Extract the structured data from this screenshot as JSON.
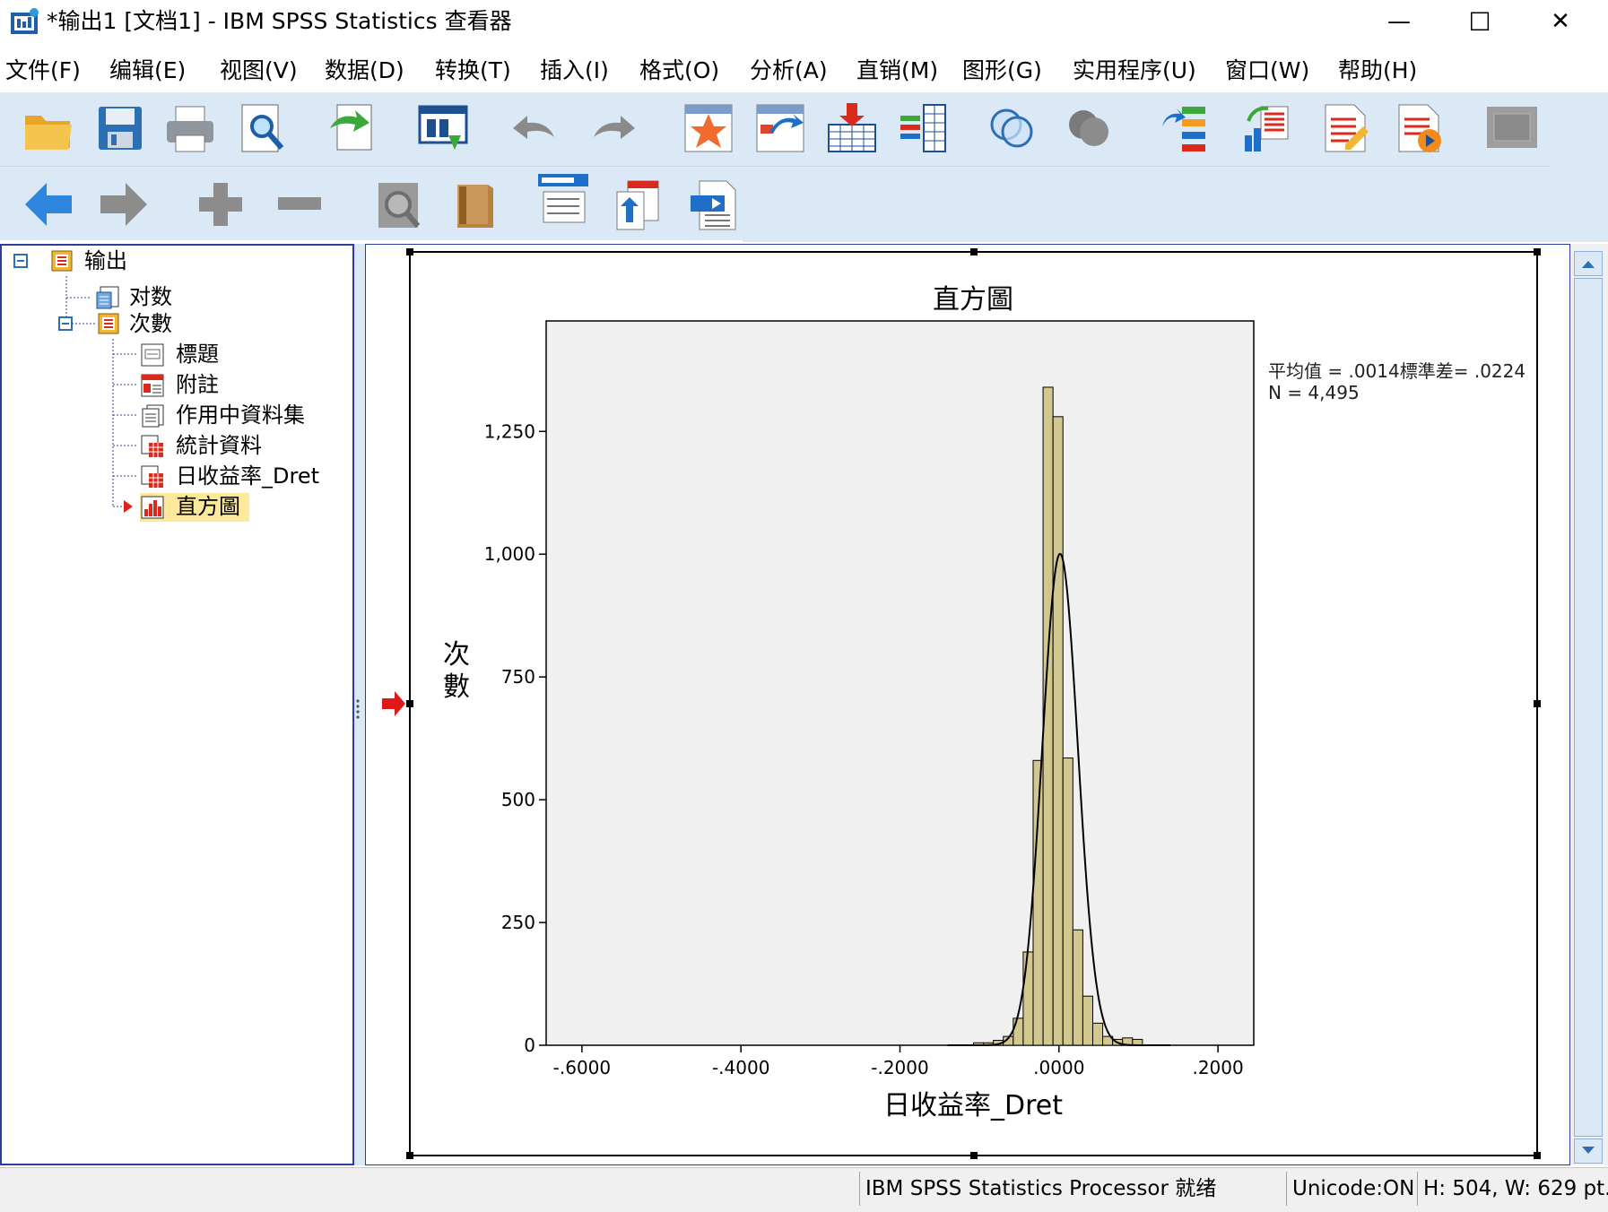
{
  "window": {
    "title": "*输出1 [文档1] - IBM SPSS Statistics 查看器",
    "minimize_glyph": "—",
    "maximize_glyph": "☐",
    "close_glyph": "✕"
  },
  "menu": [
    "文件(F)",
    "编辑(E)",
    "视图(V)",
    "数据(D)",
    "转换(T)",
    "插入(I)",
    "格式(O)",
    "分析(A)",
    "直销(M)",
    "图形(G)",
    "实用程序(U)",
    "窗口(W)",
    "帮助(H)"
  ],
  "toolbar1_icons": [
    "open-icon",
    "save-icon",
    "print-icon",
    "print-preview-icon",
    "export-icon",
    "recall-dialog-icon",
    "undo-icon",
    "redo-icon",
    "goto-case-icon",
    "goto-variable-icon",
    "insert-cases-icon",
    "variables-icon",
    "use-variable-sets-icon",
    "show-all-variables-icon",
    "split-file-icon",
    "select-cases-icon",
    "chart-builder-icon",
    "designate-window-icon",
    "run-script-icon",
    "disabled-icon"
  ],
  "toolbar2_icons": [
    "back-icon",
    "forward-icon",
    "expand-icon",
    "collapse-icon",
    "show-icon",
    "hide-icon",
    "insert-heading-icon",
    "insert-title-icon",
    "insert-text-icon"
  ],
  "outline": {
    "root": "输出",
    "log": "对数",
    "freq": "次數",
    "children": [
      "標題",
      "附註",
      "作用中資料集",
      "統計資料",
      "日收益率_Dret",
      "直方圖"
    ]
  },
  "chart_data": {
    "type": "bar",
    "title": "直方圖",
    "xlabel": "日收益率_Dret",
    "ylabel": "次數",
    "x_ticks": [
      "-.6000",
      "-.4000",
      "-.2000",
      ".0000",
      ".2000"
    ],
    "y_ticks": [
      "0",
      "250",
      "500",
      "750",
      "1,000",
      "1,250"
    ],
    "xlim": [
      -0.645,
      0.245
    ],
    "ylim": [
      0,
      1475
    ],
    "bin_width": 0.0125,
    "bins": [
      {
        "x0": -0.1075,
        "count": 5
      },
      {
        "x0": -0.095,
        "count": 5
      },
      {
        "x0": -0.0825,
        "count": 10
      },
      {
        "x0": -0.07,
        "count": 18
      },
      {
        "x0": -0.0575,
        "count": 55
      },
      {
        "x0": -0.045,
        "count": 190
      },
      {
        "x0": -0.0325,
        "count": 580
      },
      {
        "x0": -0.02,
        "count": 1340
      },
      {
        "x0": -0.0075,
        "count": 1280
      },
      {
        "x0": 0.005,
        "count": 585
      },
      {
        "x0": 0.0175,
        "count": 235
      },
      {
        "x0": 0.03,
        "count": 100
      },
      {
        "x0": 0.0425,
        "count": 45
      },
      {
        "x0": 0.055,
        "count": 18
      },
      {
        "x0": 0.0675,
        "count": 12
      },
      {
        "x0": 0.08,
        "count": 15
      },
      {
        "x0": 0.0925,
        "count": 12
      }
    ],
    "normal_curve": {
      "mean": 0.0014,
      "std": 0.0224,
      "n": 4495
    },
    "stats_line1": "平均值 = .0014標準差= .0224",
    "stats_line2": "N = 4,495",
    "bar_color": "#d2c78f",
    "plot_bg": "#f0f0f0"
  },
  "status": {
    "processor": "IBM SPSS Statistics Processor 就绪",
    "unicode": "Unicode:ON",
    "size": "H: 504, W: 629 pt."
  }
}
